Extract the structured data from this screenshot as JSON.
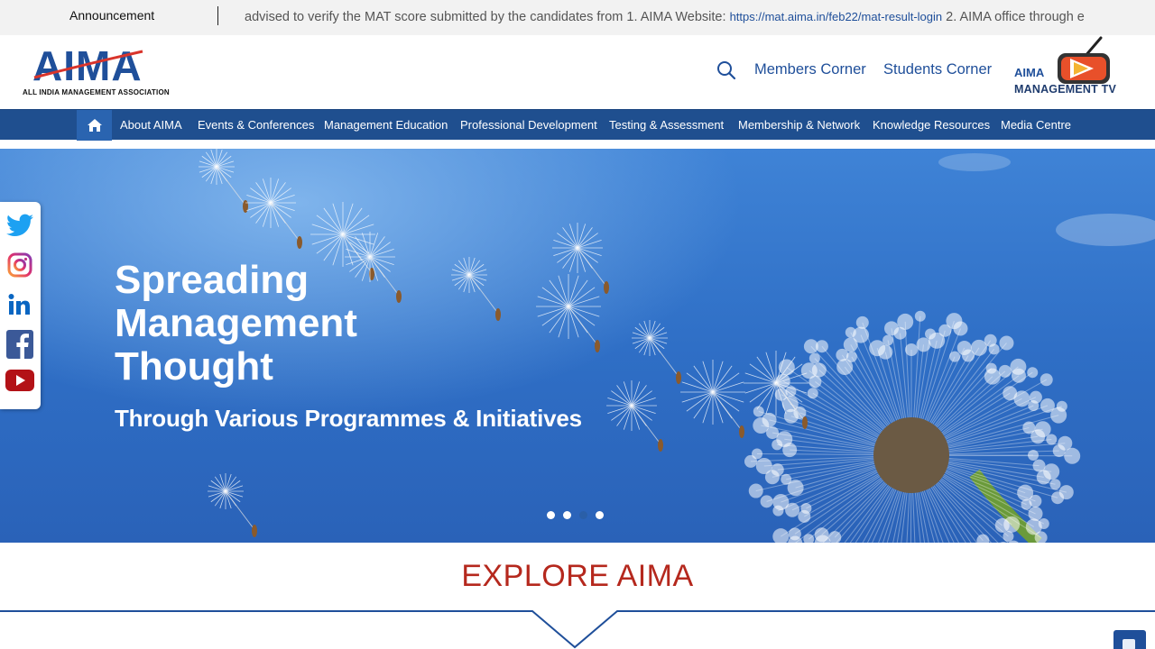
{
  "announcement": {
    "label": "Announcement",
    "text": "advised to verify the MAT score submitted by the candidates from 1. AIMA Website: ",
    "link": "https://mat.aima.in/feb22/mat-result-login",
    "text_after": " 2. AIMA office through e"
  },
  "header": {
    "logo_text": "AIMA",
    "logo_sub": "ALL INDIA MANAGEMENT ASSOCIATION",
    "members_corner": "Members Corner",
    "students_corner": "Students Corner",
    "tv_brand": "AIMA",
    "tv_label": "MANAGEMENT TV"
  },
  "nav": {
    "items": [
      {
        "label": "About AIMA"
      },
      {
        "label": "Events & Conferences"
      },
      {
        "label": "Management Education"
      },
      {
        "label": "Professional Development"
      },
      {
        "label": "Testing & Assessment"
      },
      {
        "label": "Membership & Network"
      },
      {
        "label": "Knowledge Resources"
      },
      {
        "label": "Media Centre"
      }
    ]
  },
  "hero": {
    "title_line1": "Spreading",
    "title_line2": "Management",
    "title_line3": "Thought",
    "subtitle": "Through Various Programmes & Initiatives",
    "slide_count": 4,
    "active_slide": 3
  },
  "social": [
    "twitter-icon",
    "instagram-icon",
    "linkedin-icon",
    "facebook-icon",
    "youtube-icon"
  ],
  "explore": {
    "title": "EXPLORE AIMA"
  },
  "colors": {
    "brand_blue": "#1f4f9a",
    "nav_bg": "#1f4f8f",
    "accent_red": "#b5281d"
  }
}
